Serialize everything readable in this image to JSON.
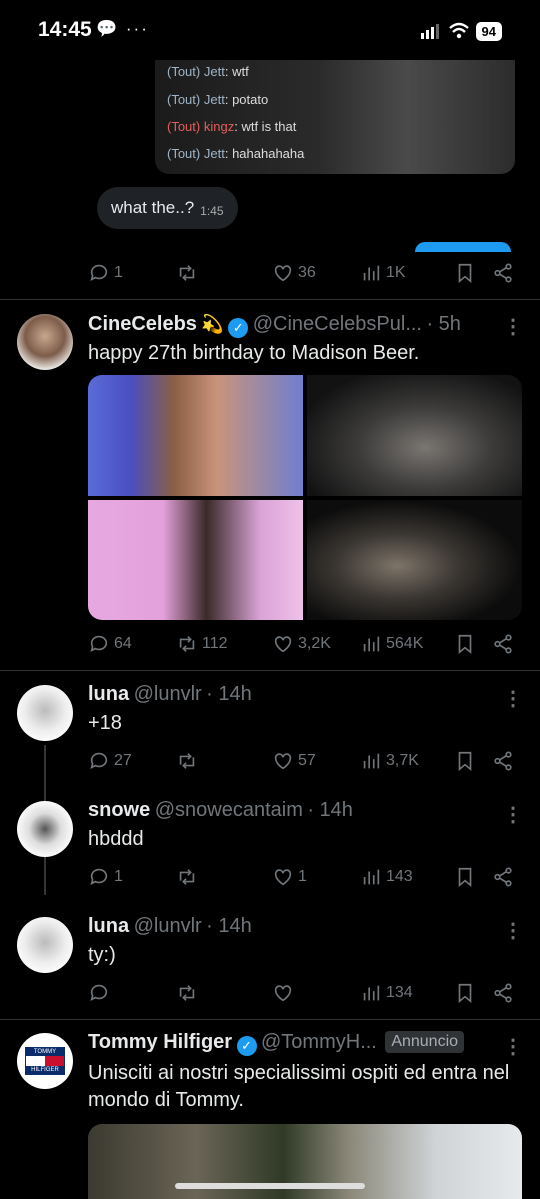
{
  "status": {
    "time": "14:45",
    "battery": "94"
  },
  "quoted_chat": {
    "lines": [
      {
        "tag": "(Tout)",
        "user": "Jett",
        "text": "wtf"
      },
      {
        "tag": "(Tout)",
        "user": "Jett",
        "text": "potato"
      },
      {
        "tag": "(Tout)",
        "user": "kingz",
        "text": "wtf is that"
      },
      {
        "tag": "(Tout)",
        "user": "Jett",
        "text": "hahahahaha"
      }
    ],
    "bubble_text": "what the..?",
    "bubble_time": "1:45"
  },
  "post0": {
    "replies": "1",
    "reposts": "",
    "likes": "36",
    "views": "1K"
  },
  "post1": {
    "name": "CineCelebs",
    "emoji": "💫",
    "handle": "@CineCelebsPul...",
    "time": "· 5h",
    "text": "happy 27th birthday to Madison Beer.",
    "replies": "64",
    "reposts": "112",
    "likes": "3,2K",
    "views": "564K"
  },
  "reply1": {
    "name": "luna",
    "handle": "@lunvlr",
    "time": "· 14h",
    "text": "+18",
    "replies": "27",
    "reposts": "",
    "likes": "57",
    "views": "3,7K"
  },
  "reply2": {
    "name": "snowe",
    "handle": "@snowecantaim",
    "time": "· 14h",
    "text": "hbddd",
    "replies": "1",
    "reposts": "",
    "likes": "1",
    "views": "143"
  },
  "reply3": {
    "name": "luna",
    "handle": "@lunvlr",
    "time": "· 14h",
    "text": "ty:)",
    "replies": "",
    "reposts": "",
    "likes": "",
    "views": "134"
  },
  "ad": {
    "name": "Tommy Hilfiger",
    "handle": "@TommyH...",
    "badge": "Annuncio",
    "text": "Unisciti ai nostri specialissimi ospiti ed entra nel mondo di Tommy.",
    "logo_top": "TOMMY",
    "logo_bottom": "HILFIGER"
  },
  "colors": {
    "accent": "#1d9bf0",
    "muted": "#71767b",
    "bg": "#000000"
  }
}
